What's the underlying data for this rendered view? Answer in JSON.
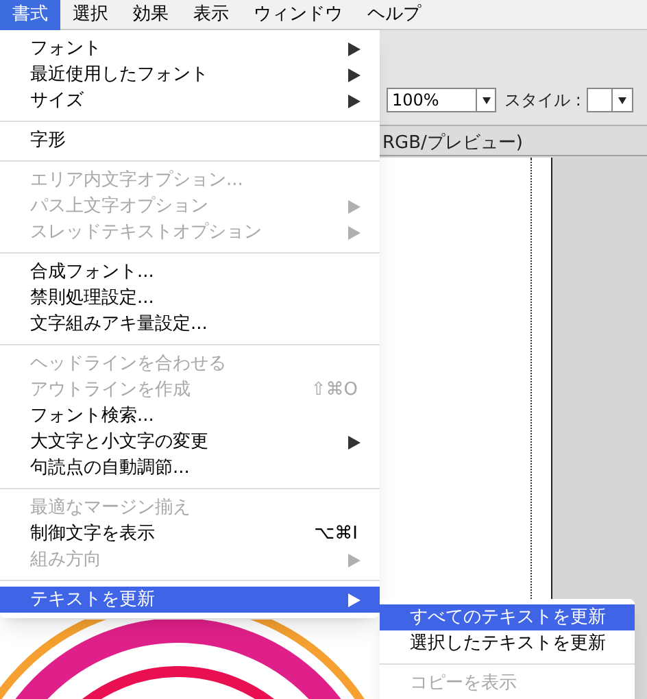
{
  "menu_bar": [
    {
      "label": "書式",
      "selected": true
    },
    {
      "label": "選択",
      "selected": false
    },
    {
      "label": "効果",
      "selected": false
    },
    {
      "label": "表示",
      "selected": false
    },
    {
      "label": "ウィンドウ",
      "selected": false
    },
    {
      "label": "ヘルプ",
      "selected": false
    }
  ],
  "toolbar": {
    "zoom": "100%",
    "style_label": "スタイル :"
  },
  "document_title": "RGB/プレビュー)",
  "menu": [
    {
      "kind": "item",
      "label": "フォント",
      "disabled": false,
      "submenu": true,
      "selected": false
    },
    {
      "kind": "item",
      "label": "最近使用したフォント",
      "disabled": false,
      "submenu": true,
      "selected": false
    },
    {
      "kind": "item",
      "label": "サイズ",
      "disabled": false,
      "submenu": true,
      "selected": false
    },
    {
      "kind": "separator"
    },
    {
      "kind": "item",
      "label": "字形",
      "disabled": false,
      "submenu": false,
      "selected": false
    },
    {
      "kind": "separator"
    },
    {
      "kind": "item",
      "label": "エリア内文字オプション...",
      "disabled": true,
      "submenu": false,
      "selected": false
    },
    {
      "kind": "item",
      "label": "パス上文字オプション",
      "disabled": true,
      "submenu": true,
      "selected": false
    },
    {
      "kind": "item",
      "label": "スレッドテキストオプション",
      "disabled": true,
      "submenu": true,
      "selected": false
    },
    {
      "kind": "separator"
    },
    {
      "kind": "item",
      "label": "合成フォント...",
      "disabled": false,
      "submenu": false,
      "selected": false
    },
    {
      "kind": "item",
      "label": "禁則処理設定...",
      "disabled": false,
      "submenu": false,
      "selected": false
    },
    {
      "kind": "item",
      "label": "文字組みアキ量設定...",
      "disabled": false,
      "submenu": false,
      "selected": false
    },
    {
      "kind": "separator"
    },
    {
      "kind": "item",
      "label": "ヘッドラインを合わせる",
      "disabled": true,
      "submenu": false,
      "selected": false
    },
    {
      "kind": "item",
      "label": "アウトラインを作成",
      "disabled": true,
      "submenu": false,
      "selected": false,
      "shortcut": "⇧⌘O"
    },
    {
      "kind": "item",
      "label": "フォント検索...",
      "disabled": false,
      "submenu": false,
      "selected": false
    },
    {
      "kind": "item",
      "label": "大文字と小文字の変更",
      "disabled": false,
      "submenu": true,
      "selected": false
    },
    {
      "kind": "item",
      "label": "句読点の自動調節...",
      "disabled": false,
      "submenu": false,
      "selected": false
    },
    {
      "kind": "separator"
    },
    {
      "kind": "item",
      "label": "最適なマージン揃え",
      "disabled": true,
      "submenu": false,
      "selected": false
    },
    {
      "kind": "item",
      "label": "制御文字を表示",
      "disabled": false,
      "submenu": false,
      "selected": false,
      "shortcut": "⌥⌘I"
    },
    {
      "kind": "item",
      "label": "組み方向",
      "disabled": true,
      "submenu": true,
      "selected": false
    },
    {
      "kind": "separator"
    },
    {
      "kind": "item",
      "label": "テキストを更新",
      "disabled": false,
      "submenu": true,
      "selected": true
    }
  ],
  "submenu": [
    {
      "kind": "item",
      "label": "すべてのテキストを更新",
      "disabled": false,
      "selected": true
    },
    {
      "kind": "item",
      "label": "選択したテキストを更新",
      "disabled": false,
      "selected": false
    },
    {
      "kind": "separator"
    },
    {
      "kind": "item",
      "label": "コピーを表示",
      "disabled": true,
      "selected": false
    }
  ]
}
